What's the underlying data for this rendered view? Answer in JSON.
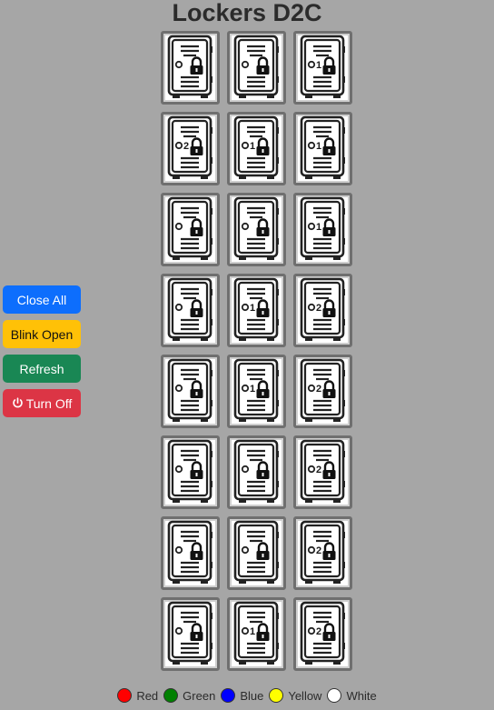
{
  "title": "Lockers D2C",
  "buttons": {
    "close_all": "Close All",
    "blink_open": "Blink Open",
    "refresh": "Refresh",
    "turn_off": "Turn Off"
  },
  "lockers": [
    {
      "number": "",
      "state": "locked"
    },
    {
      "number": "",
      "state": "locked"
    },
    {
      "number": "1",
      "state": "locked"
    },
    {
      "number": "2",
      "state": "locked"
    },
    {
      "number": "1",
      "state": "locked"
    },
    {
      "number": "1",
      "state": "locked"
    },
    {
      "number": "",
      "state": "locked"
    },
    {
      "number": "",
      "state": "locked"
    },
    {
      "number": "1",
      "state": "locked"
    },
    {
      "number": "",
      "state": "locked"
    },
    {
      "number": "1",
      "state": "locked"
    },
    {
      "number": "2",
      "state": "locked"
    },
    {
      "number": "",
      "state": "locked"
    },
    {
      "number": "1",
      "state": "locked"
    },
    {
      "number": "2",
      "state": "locked"
    },
    {
      "number": "",
      "state": "locked"
    },
    {
      "number": "",
      "state": "locked"
    },
    {
      "number": "2",
      "state": "locked"
    },
    {
      "number": "",
      "state": "locked"
    },
    {
      "number": "",
      "state": "locked"
    },
    {
      "number": "2",
      "state": "locked"
    },
    {
      "number": "",
      "state": "locked"
    },
    {
      "number": "1",
      "state": "locked"
    },
    {
      "number": "2",
      "state": "locked"
    }
  ],
  "legend": [
    {
      "label": "Red",
      "color": "#ff0000"
    },
    {
      "label": "Green",
      "color": "#008000"
    },
    {
      "label": "Blue",
      "color": "#0000ff"
    },
    {
      "label": "Yellow",
      "color": "#ffff00"
    },
    {
      "label": "White",
      "color": "#ffffff"
    }
  ]
}
